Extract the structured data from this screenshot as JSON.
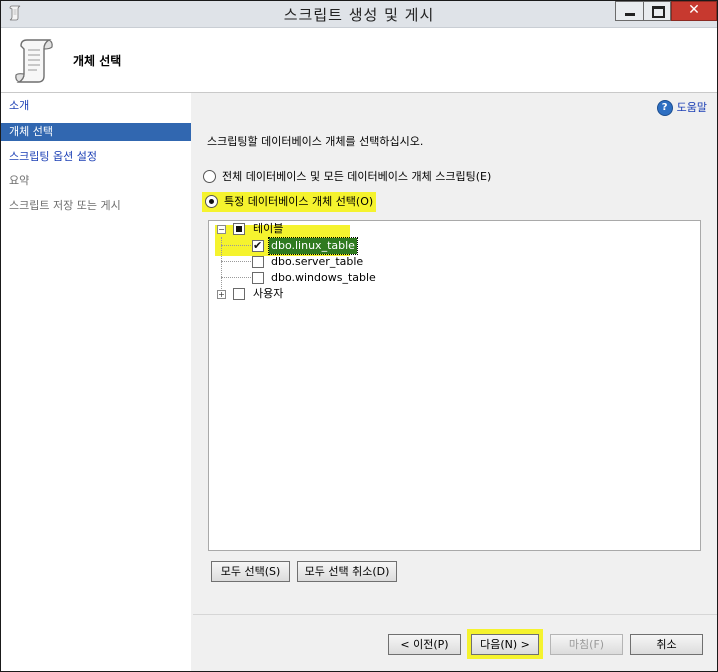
{
  "window": {
    "title": "스크립트 생성 및 게시"
  },
  "header": {
    "title": "개체 선택"
  },
  "sidebar": {
    "items": [
      {
        "label": "소개",
        "state": "link"
      },
      {
        "label": "개체 선택",
        "state": "selected"
      },
      {
        "label": "스크립팅 옵션 설정",
        "state": "link"
      },
      {
        "label": "요약",
        "state": "muted"
      },
      {
        "label": "스크립트 저장 또는 게시",
        "state": "muted"
      }
    ]
  },
  "main": {
    "help_label": "도움말",
    "instruction": "스크립팅할 데이터베이스 개체를 선택하십시오.",
    "options": [
      {
        "label": "전체 데이터베이스 및 모든 데이터베이스 개체 스크립팅(E)",
        "selected": false
      },
      {
        "label": "특정 데이터베이스 개체 선택(O)",
        "selected": true
      }
    ],
    "tree": {
      "tables": {
        "label": "테이블",
        "children": [
          {
            "label": "dbo.linux_table",
            "checked": true
          },
          {
            "label": "dbo.server_table",
            "checked": false
          },
          {
            "label": "dbo.windows_table",
            "checked": false
          }
        ]
      },
      "users": {
        "label": "사용자"
      }
    },
    "select_all": "모두 선택(S)",
    "deselect_all": "모두 선택 취소(D)"
  },
  "footer": {
    "prev": "< 이전(P)",
    "next": "다음(N) >",
    "finish": "마침(F)",
    "cancel": "취소"
  },
  "colors": {
    "selection_blue": "#3167b0",
    "highlight_yellow": "#f5f32e",
    "tree_selected_green": "#2f7a1f",
    "link_blue": "#1b3fb5"
  },
  "icons": [
    "scroll-icon",
    "help-icon",
    "minimize-icon",
    "maximize-icon",
    "close-icon"
  ]
}
